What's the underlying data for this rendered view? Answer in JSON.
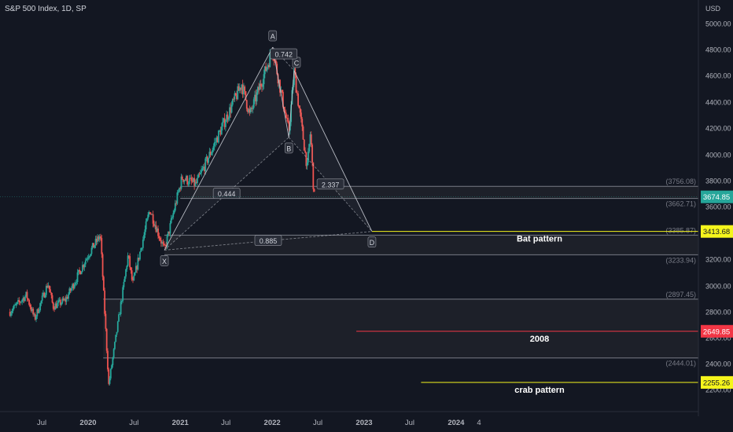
{
  "chart": {
    "symbol_title": "S&P 500 Index, 1D, SP",
    "currency": "USD",
    "colors": {
      "background": "#131722",
      "up": "#26a69a",
      "down": "#ef5350",
      "pattern": "#c9ccd4",
      "zone_fill": "#1d2029",
      "zone_line": "#787b86",
      "yellow": "#f5f51c",
      "red": "#f23645",
      "current_price_bg": "#26a69a"
    }
  },
  "chart_data": {
    "type": "candlestick",
    "instrument": "S&P 500 Index",
    "interval": "1D",
    "exchange": "SP",
    "y_axis": {
      "unit": "USD",
      "ylim": [
        2000,
        5100
      ],
      "ticks": [
        2200,
        2400,
        2600,
        2800,
        3000,
        3200,
        3400,
        3600,
        3800,
        4000,
        4200,
        4400,
        4600,
        4800,
        5000
      ],
      "tick_labels": [
        "2200.00",
        "2400.00",
        "2600.00",
        "2800.00",
        "3000.00",
        "3200.00",
        "3400.00",
        "3600.00",
        "3800.00",
        "4000.00",
        "4200.00",
        "4400.00",
        "4600.00",
        "4800.00",
        "5000.00"
      ]
    },
    "x_axis": {
      "ticks": [
        {
          "date": "2019-07-01",
          "label": "Jul"
        },
        {
          "date": "2020-01-01",
          "label": "2020"
        },
        {
          "date": "2020-07-01",
          "label": "Jul"
        },
        {
          "date": "2021-01-01",
          "label": "2021"
        },
        {
          "date": "2021-07-01",
          "label": "Jul"
        },
        {
          "date": "2022-01-01",
          "label": "2022"
        },
        {
          "date": "2022-07-01",
          "label": "Jul"
        },
        {
          "date": "2023-01-01",
          "label": "2023"
        },
        {
          "date": "2023-07-01",
          "label": "Jul"
        },
        {
          "date": "2024-01-01",
          "label": "2024"
        },
        {
          "date": "2024-04-01",
          "label": "4"
        }
      ]
    },
    "price_path": [
      {
        "date": "2019-02-25",
        "close": 2800
      },
      {
        "date": "2019-05-01",
        "close": 2930
      },
      {
        "date": "2019-06-03",
        "close": 2745
      },
      {
        "date": "2019-07-26",
        "close": 3020
      },
      {
        "date": "2019-08-15",
        "close": 2840
      },
      {
        "date": "2019-10-03",
        "close": 2890
      },
      {
        "date": "2019-12-31",
        "close": 3230
      },
      {
        "date": "2020-02-19",
        "close": 3386
      },
      {
        "date": "2020-03-23",
        "close": 2237
      },
      {
        "date": "2020-06-08",
        "close": 3232
      },
      {
        "date": "2020-06-26",
        "close": 3009
      },
      {
        "date": "2020-09-02",
        "close": 3580
      },
      {
        "date": "2020-10-30",
        "close": 3270
      },
      {
        "date": "2021-01-08",
        "close": 3824
      },
      {
        "date": "2021-03-04",
        "close": 3770
      },
      {
        "date": "2021-09-02",
        "close": 4537
      },
      {
        "date": "2021-10-04",
        "close": 4300
      },
      {
        "date": "2022-01-03",
        "close": 4796
      },
      {
        "date": "2022-03-08",
        "close": 4170
      },
      {
        "date": "2022-03-29",
        "close": 4631
      },
      {
        "date": "2022-05-20",
        "close": 3900
      },
      {
        "date": "2022-06-02",
        "close": 4176
      },
      {
        "date": "2022-06-16",
        "close": 3666
      },
      {
        "date": "2022-06-17",
        "close": 3674.85
      }
    ],
    "harmonic_pattern": {
      "points": [
        {
          "label": "X",
          "date": "2020-10-30",
          "price": 3270
        },
        {
          "label": "A",
          "date": "2022-01-03",
          "price": 4818
        },
        {
          "label": "B",
          "date": "2022-03-08",
          "price": 4130
        },
        {
          "label": "C",
          "date": "2022-03-29",
          "price": 4637
        },
        {
          "label": "D",
          "date": "2023-02-01",
          "price": 3413.68
        }
      ],
      "ratios": [
        {
          "value": "0.444",
          "between": [
            "X",
            "B"
          ]
        },
        {
          "value": "0.742",
          "between": [
            "A",
            "C"
          ]
        },
        {
          "value": "2.337",
          "between": [
            "B",
            "D"
          ]
        },
        {
          "value": "0.885",
          "between": [
            "X",
            "D"
          ]
        }
      ]
    },
    "zones": [
      {
        "top": 3756.08,
        "bottom": 3662.71,
        "top_label": "(3756.08)",
        "bottom_label": "(3662.71)",
        "start": "2021-01-01"
      },
      {
        "top": 3385.87,
        "bottom": 3233.94,
        "top_label": "(3385.87)",
        "bottom_label": "(3233.94)",
        "start": "2020-10-30"
      },
      {
        "top": 2897.45,
        "bottom": 2444.01,
        "top_label": "(2897.45)",
        "bottom_label": "(2444.01)",
        "start": "2020-03-01"
      }
    ],
    "horizontal_lines": [
      {
        "price": 3413.68,
        "label": "3413.68",
        "text": "Bat pattern",
        "color": "#f5f51c",
        "start": "2023-02-01"
      },
      {
        "price": 2649.85,
        "label": "2649.85",
        "text": "2008",
        "color": "#f23645",
        "start": "2022-12-01"
      },
      {
        "price": 2255.26,
        "label": "2255.26",
        "text": "crab pattern",
        "color": "#f5f51c",
        "start": "2023-08-15"
      }
    ],
    "current_price": {
      "value": 3674.85,
      "label": "3674.85"
    }
  }
}
